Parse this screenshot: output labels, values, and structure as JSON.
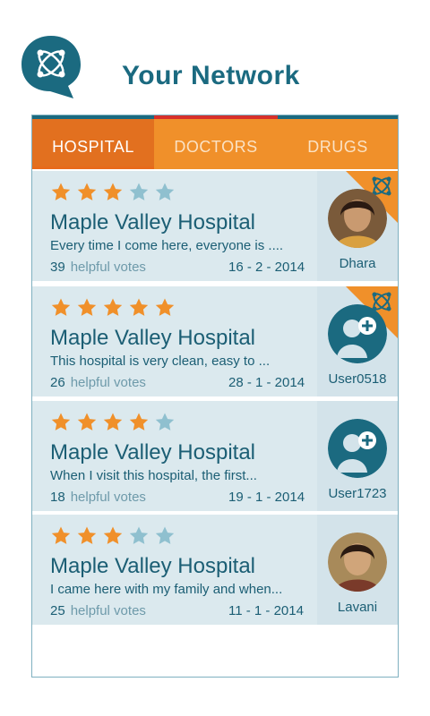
{
  "header": {
    "title": "Your Network",
    "logo_icon": "network-chat-icon"
  },
  "tabs": [
    {
      "label": "HOSPITAL",
      "active": true
    },
    {
      "label": "DOCTORS",
      "active": false
    },
    {
      "label": "DRUGS",
      "active": false
    }
  ],
  "colors": {
    "accent": "#f0902a",
    "primary": "#1b6a80",
    "star_filled": "#f0902a",
    "star_empty": "#8fc0cf",
    "card_bg": "#dbe9ee"
  },
  "reviews": [
    {
      "rating": 3,
      "out_of": 5,
      "hospital": "Maple Valley Hospital",
      "snippet": "Every time I come here, everyone is ....",
      "votes": "39",
      "votes_label": "helpful votes",
      "date": "16  - 2 - 2014",
      "user": "Dhara",
      "avatar": "photo",
      "network_badge": true
    },
    {
      "rating": 5,
      "out_of": 5,
      "hospital": "Maple Valley Hospital",
      "snippet": "This hospital is very clean, easy to ...",
      "votes": "26",
      "votes_label": "helpful votes",
      "date": "28 - 1 - 2014",
      "user": "User0518",
      "avatar": "placeholder",
      "network_badge": true
    },
    {
      "rating": 4,
      "out_of": 5,
      "hospital": "Maple Valley Hospital",
      "snippet": "When I visit this hospital, the first...",
      "votes": "18",
      "votes_label": "helpful votes",
      "date": "19 - 1 - 2014",
      "user": "User1723",
      "avatar": "placeholder",
      "network_badge": false
    },
    {
      "rating": 3,
      "out_of": 5,
      "hospital": "Maple Valley Hospital",
      "snippet": "I came here with my family and when...",
      "votes": "25",
      "votes_label": "helpful votes",
      "date": "11 - 1 - 2014",
      "user": "Lavani",
      "avatar": "photo",
      "network_badge": false
    }
  ]
}
